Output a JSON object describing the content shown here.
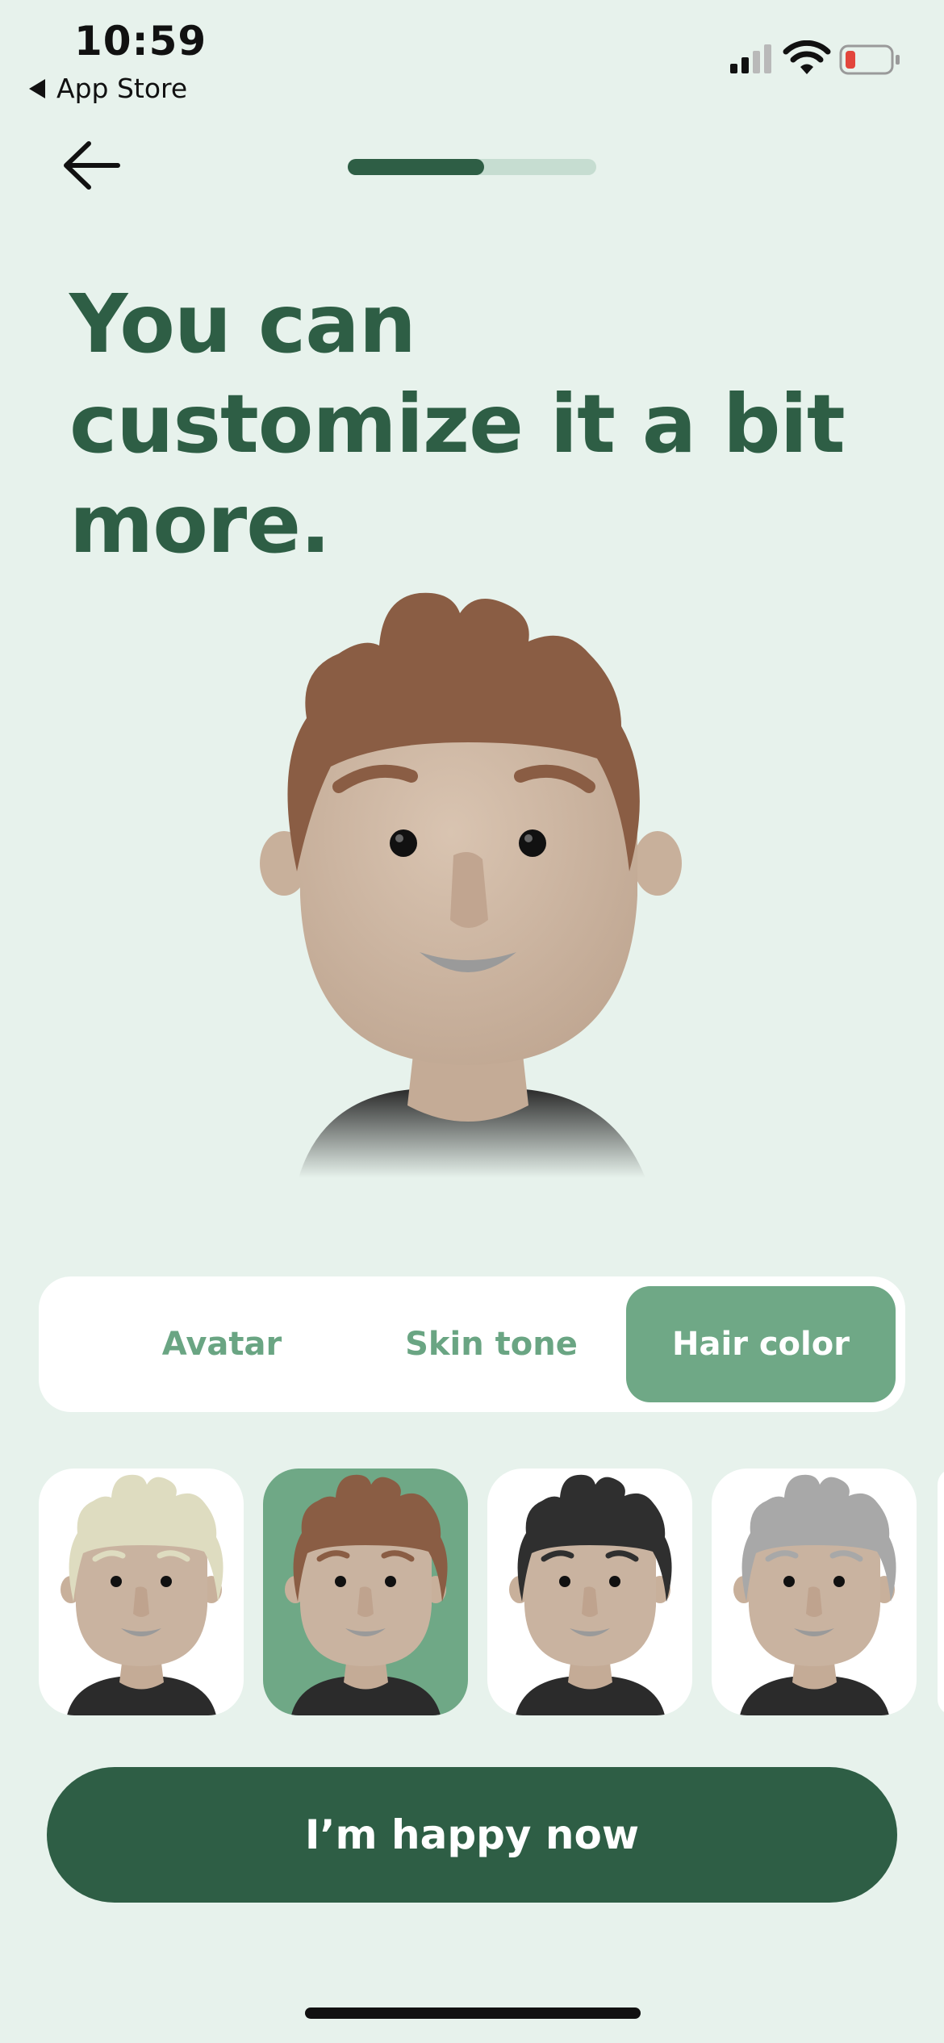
{
  "status_bar": {
    "time": "10:59",
    "back_app_label": "App Store",
    "battery_color": "#e2453c"
  },
  "nav": {
    "back_icon": "arrow-left-icon",
    "progress_fraction": 0.55
  },
  "headline": "You can customize it a bit more.",
  "avatar": {
    "hair_color": "#8a5d44",
    "skin_color": "#cdb6a2",
    "shirt_color": "#2b2b2b"
  },
  "tabs": [
    {
      "label": "Avatar",
      "active": false
    },
    {
      "label": "Skin tone",
      "active": false
    },
    {
      "label": "Hair color",
      "active": true
    }
  ],
  "hair_options": [
    {
      "name": "blonde",
      "color": "#dedcc0",
      "selected": false
    },
    {
      "name": "brown",
      "color": "#8a5d44",
      "selected": true
    },
    {
      "name": "black",
      "color": "#2f2f2f",
      "selected": false
    },
    {
      "name": "gray",
      "color": "#a8a8a8",
      "selected": false
    }
  ],
  "cta_label": "I’m happy now",
  "colors": {
    "background": "#e7f2ec",
    "primary": "#2e5e45",
    "accent": "#6fa886"
  }
}
